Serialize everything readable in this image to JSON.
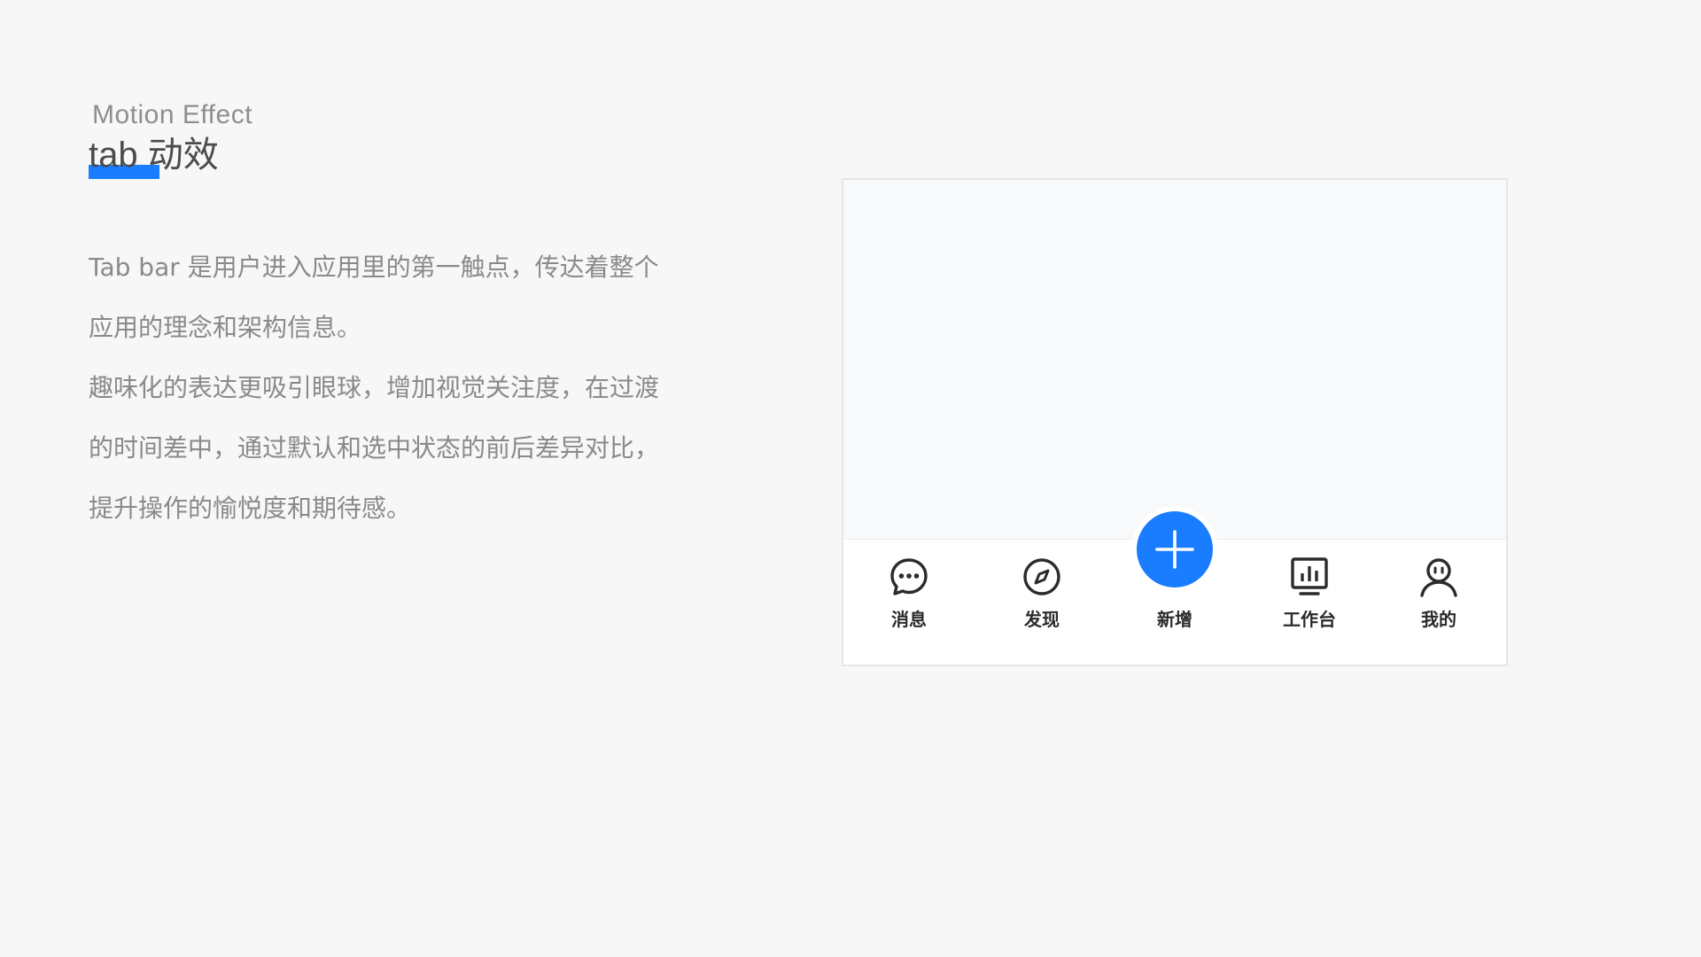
{
  "header": {
    "eyebrow": "Motion Effect",
    "title": "tab 动效"
  },
  "description": {
    "paragraphs": [
      "Tab bar 是用户进入应用里的第一触点，传达着整个",
      "应用的理念和架构信息。",
      "趣味化的表达更吸引眼球，增加视觉关注度，在过渡",
      "的时间差中，通过默认和选中状态的前后差异对比，",
      "提升操作的愉悦度和期待感。"
    ]
  },
  "tabbar": {
    "accent_color": "#1a7cff",
    "items": [
      {
        "label": "消息",
        "icon": "message-icon"
      },
      {
        "label": "发现",
        "icon": "compass-icon"
      },
      {
        "label": "新增",
        "icon": "plus-icon"
      },
      {
        "label": "工作台",
        "icon": "dashboard-icon"
      },
      {
        "label": "我的",
        "icon": "user-icon"
      }
    ]
  }
}
